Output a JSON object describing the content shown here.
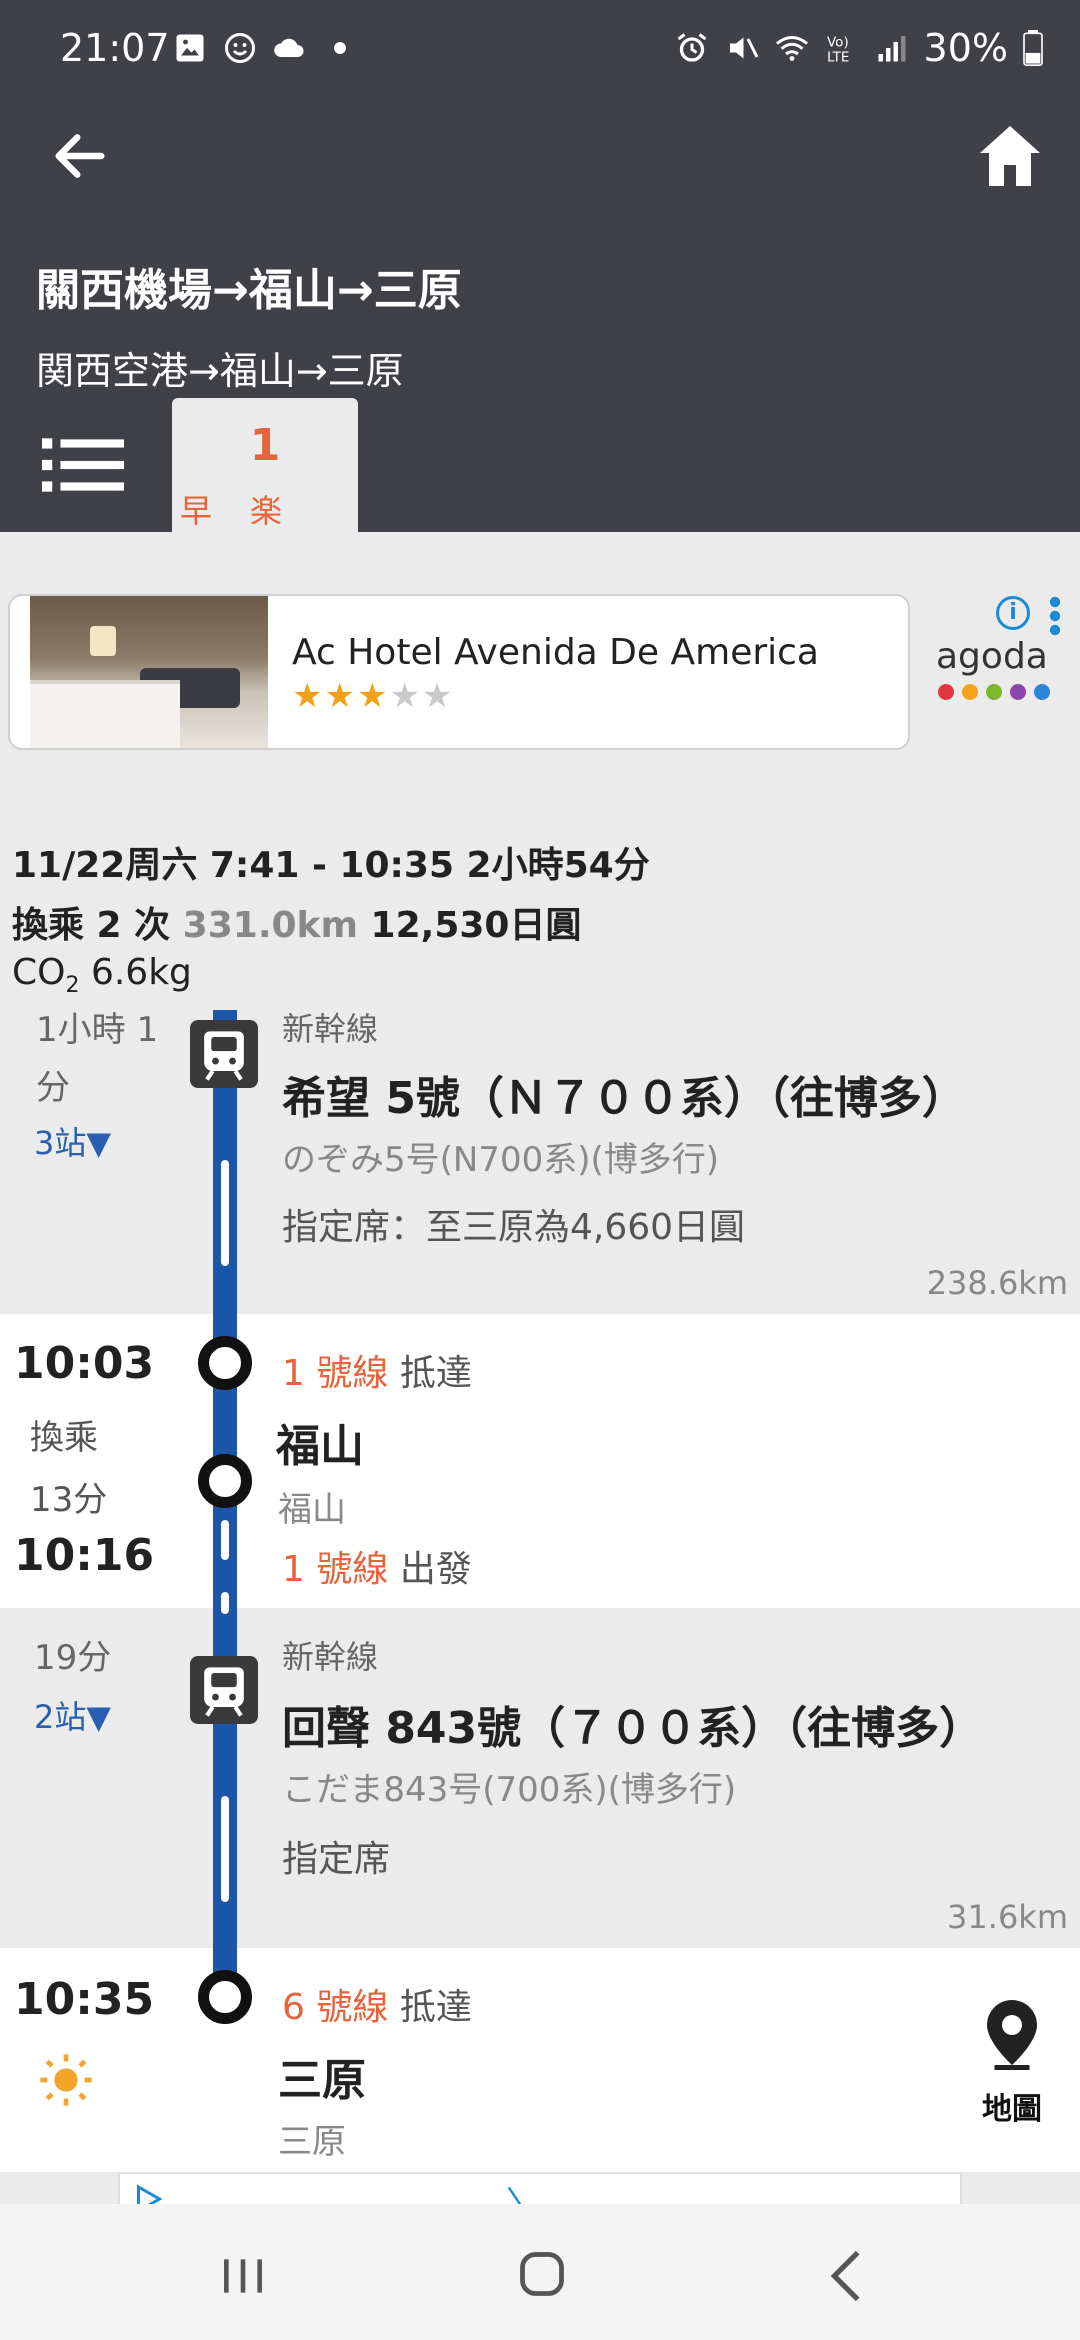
{
  "status": {
    "time": "21:07",
    "battery": "30%"
  },
  "header": {
    "title": "關西機場→福山→三原",
    "subtitle": "関西空港→福山→三原"
  },
  "tabs": [
    {
      "number": "1",
      "label": "早楽"
    }
  ],
  "ad": {
    "hotel_name": "Ac Hotel Avenida De America",
    "stars_on": "★★★",
    "stars_off": "★★",
    "brand": "agoda",
    "info_symbol": "i"
  },
  "summary": {
    "line1": "11/22周六 7:41 - 10:35 2小時54分",
    "transfers": "換乘 2 次",
    "distance": "331.0km",
    "fare": "12,530日圓",
    "co2_prefix": "CO",
    "co2_sub": "2",
    "co2_value": "6.6kg"
  },
  "segment1": {
    "duration_cut": "1小時 1",
    "duration_unit": "分",
    "stations": "3站▼",
    "line_type": "新幹線",
    "train_name": "希望 5號（Ｎ７００系）（往博多）",
    "train_name_jp": "のぞみ5号(N700系)(博多行)",
    "seat_info": "指定席：至三原為4,660日圓",
    "distance": "238.6km"
  },
  "transfer1": {
    "arrive_time": "10:03",
    "arrive_track": "1 號線",
    "arrive_label": "抵達",
    "transfer_label": "換乘",
    "wait": "13分",
    "station": "福山",
    "station_jp": "福山",
    "depart_time": "10:16",
    "depart_track": "1 號線",
    "depart_label": "出發"
  },
  "segment2": {
    "duration": "19分",
    "stations": "2站▼",
    "line_type": "新幹線",
    "train_name": "回聲 843號（７００系）（往博多）",
    "train_name_jp": "こだま843号(700系)(博多行)",
    "seat_info": "指定席",
    "distance": "31.6km"
  },
  "arrival": {
    "time": "10:35",
    "track": "6 號線",
    "label": "抵達",
    "station": "三原",
    "station_jp": "三原",
    "map_label": "地圖"
  },
  "colors": {
    "header_bg": "#3f4147",
    "accent_orange": "#e8633a",
    "line_blue": "#1c56a8",
    "link_blue": "#2a5fb0"
  }
}
